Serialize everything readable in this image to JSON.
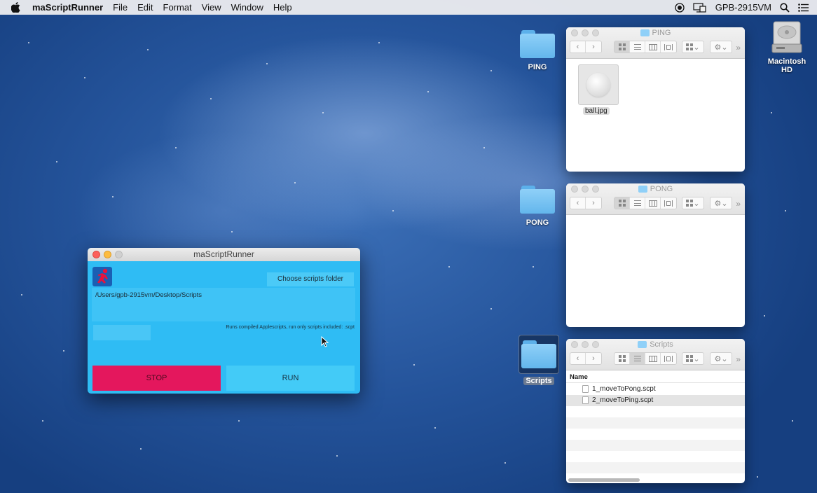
{
  "menubar": {
    "app_name": "maScriptRunner",
    "items": [
      "File",
      "Edit",
      "Format",
      "View",
      "Window",
      "Help"
    ],
    "host_name": "GPB-2915VM"
  },
  "desktop": {
    "icons": [
      {
        "label": "PING",
        "icon": "folder-icon"
      },
      {
        "label": "PONG",
        "icon": "folder-icon"
      },
      {
        "label": "Scripts",
        "icon": "folder-icon"
      },
      {
        "label": "Macintosh HD",
        "icon": "hard-drive-icon"
      }
    ]
  },
  "runner": {
    "title": "maScriptRunner",
    "choose_label": "Choose scripts folder",
    "path": "/Users/gpb-2915vm/Desktop/Scripts",
    "info": "Runs compiled Applescripts, run only scripts included: .scpt",
    "stop_label": "STOP",
    "run_label": "RUN",
    "colors": {
      "background": "#2fbcf4",
      "stop": "#e4175d",
      "run": "#43cbf7"
    }
  },
  "finders": {
    "ping": {
      "title": "PING",
      "files": [
        "ball.jpg"
      ]
    },
    "pong": {
      "title": "PONG",
      "files": []
    },
    "scripts": {
      "title": "Scripts",
      "column_header": "Name",
      "files": [
        "1_moveToPong.scpt",
        "2_moveToPing.scpt"
      ]
    }
  }
}
